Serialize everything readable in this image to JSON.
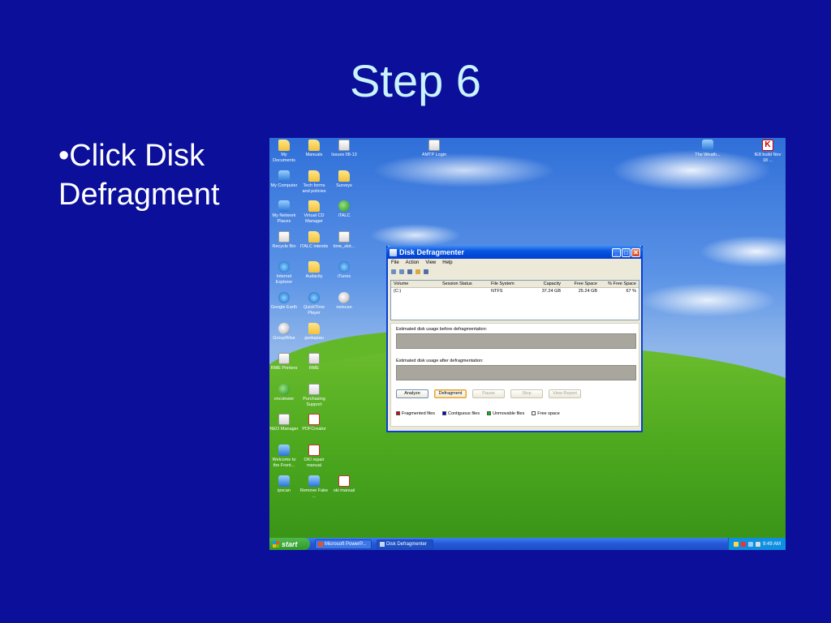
{
  "slide": {
    "title": "Step 6",
    "bullet": "•Click Disk Defragment"
  },
  "desktop": {
    "icons_left": [
      {
        "label": "My Documents",
        "icon": "documents-icon"
      },
      {
        "label": "My Computer",
        "icon": "computer-icon"
      },
      {
        "label": "My Network Places",
        "icon": "network-icon"
      },
      {
        "label": "Recycle Bin",
        "icon": "recycle-bin-icon"
      },
      {
        "label": "Internet Explorer",
        "icon": "internet-explorer-icon"
      },
      {
        "label": "Google Earth",
        "icon": "globe-icon"
      },
      {
        "label": "GroupWise",
        "icon": "groupwise-icon"
      },
      {
        "label": "RME Printers",
        "icon": "printer-icon"
      },
      {
        "label": "vncviewer",
        "icon": "viewer-icon"
      },
      {
        "label": "NEO Manager",
        "icon": "neo-icon"
      },
      {
        "label": "Welcome to the Front...",
        "icon": "frontpage-icon"
      },
      {
        "label": "ipscan",
        "icon": "ipscan-icon"
      }
    ],
    "icons_mid": [
      {
        "label": "Manuals",
        "icon": "folder-icon"
      },
      {
        "label": "Tech forms and policies",
        "icon": "folder-icon"
      },
      {
        "label": "Virtual CD Manager",
        "icon": "folder-icon"
      },
      {
        "label": "ITALC intends",
        "icon": "folder-icon"
      },
      {
        "label": "Audacity",
        "icon": "folder-icon"
      },
      {
        "label": "QuickTime Player",
        "icon": "quicktime-icon"
      },
      {
        "label": "gwdapiau",
        "icon": "book-icon"
      },
      {
        "label": "RME",
        "icon": "document-icon"
      },
      {
        "label": "Purchasing Support",
        "icon": "document-icon"
      },
      {
        "label": "PDFCreator",
        "icon": "pdf-icon"
      },
      {
        "label": "OKI repair manual",
        "icon": "pdf-icon"
      },
      {
        "label": "Remove Fake ...",
        "icon": "shield-icon"
      }
    ],
    "icons_col3": [
      {
        "label": "Issues 08-13",
        "icon": "document-icon"
      },
      {
        "label": "Surveys",
        "icon": "folder-icon"
      },
      {
        "label": "iTALC",
        "icon": "italc-icon"
      },
      {
        "label": "time_slot...",
        "icon": "document-icon"
      },
      {
        "label": "iTunes",
        "icon": "itunes-icon"
      },
      {
        "label": "netscan",
        "icon": "soccer-ball-icon"
      },
      {
        "label": "oki manual",
        "icon": "pdf-icon"
      }
    ],
    "icon_top_center": {
      "label": "AMTP Login",
      "icon": "document-icon"
    },
    "icon_top_right1": {
      "label": "The Weath...",
      "icon": "weather-icon"
    },
    "icon_top_right2": {
      "label": "IE8 build Nov 18 ...",
      "icon": "kaspersky-icon",
      "glyph": "K"
    }
  },
  "window": {
    "title": "Disk Defragmenter",
    "controls": {
      "minimize": "_",
      "maximize": "□",
      "close": "✕"
    },
    "menu": [
      "File",
      "Action",
      "View",
      "Help"
    ],
    "columns": [
      "Volume",
      "Session Status",
      "File System",
      "Capacity",
      "Free Space",
      "% Free Space"
    ],
    "rows": [
      {
        "volume": "(C:)",
        "status": "",
        "fs": "NTFS",
        "capacity": "37.24 GB",
        "free": "25.24 GB",
        "pct": "67 %"
      }
    ],
    "before_label": "Estimated disk usage before defragmentation:",
    "after_label": "Estimated disk usage after defragmentation:",
    "buttons": {
      "analyze": "Analyze",
      "defragment": "Defragment",
      "pause": "Pause",
      "stop": "Stop",
      "view_report": "View Report"
    },
    "legend": [
      {
        "label": "Fragmented files",
        "color": "#e00000"
      },
      {
        "label": "Contiguous files",
        "color": "#0000e0"
      },
      {
        "label": "Unmovable files",
        "color": "#00c000"
      },
      {
        "label": "Free space",
        "color": "#ffffff"
      }
    ]
  },
  "taskbar": {
    "start_label": "start",
    "tasks": [
      {
        "label": "Microsoft PowerP...",
        "active": false
      },
      {
        "label": "Disk Defragmenter",
        "active": true
      }
    ],
    "clock": "9:49 AM"
  }
}
